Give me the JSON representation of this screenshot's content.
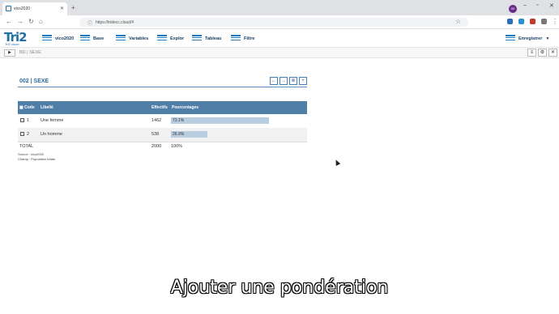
{
  "browser": {
    "tab_title": "vico2020",
    "url": "https://tridecc.cloud/#",
    "profile_initials": "00"
  },
  "app": {
    "logo_text": "Tri2",
    "logo_subtext": "Tri2 cloud",
    "menu": {
      "dataset": "vico2020",
      "base": "Base",
      "variables": "Variables",
      "explore": "Explor",
      "table": "Tableau",
      "filter": "Filtre",
      "save": "Enregistrer"
    }
  },
  "breadcrumb": {
    "toggle_label": "▶",
    "text": "BD | SEXE"
  },
  "view": {
    "title": "002 | SEXE",
    "table": {
      "headers": [
        "Code",
        "Libellé",
        "Effectifs",
        "Pourcentages"
      ],
      "rows": [
        {
          "code": "1",
          "label": "Une femme",
          "count": "1462",
          "percent_text": "73.1%",
          "percent": 73.1
        },
        {
          "code": "2",
          "label": "Un homme",
          "count": "538",
          "percent_text": "26.9%",
          "percent": 26.9
        }
      ],
      "total": {
        "label": "TOTAL",
        "count": "2000",
        "percent_text": "100%"
      }
    },
    "source": "Source : vico2020",
    "scope": "Champ : Population totale"
  },
  "caption": "Ajouter une pondération",
  "colors": {
    "accent": "#1f6fa8",
    "table_header": "#4f7fa6",
    "bar_fill": "#b9cde0"
  }
}
